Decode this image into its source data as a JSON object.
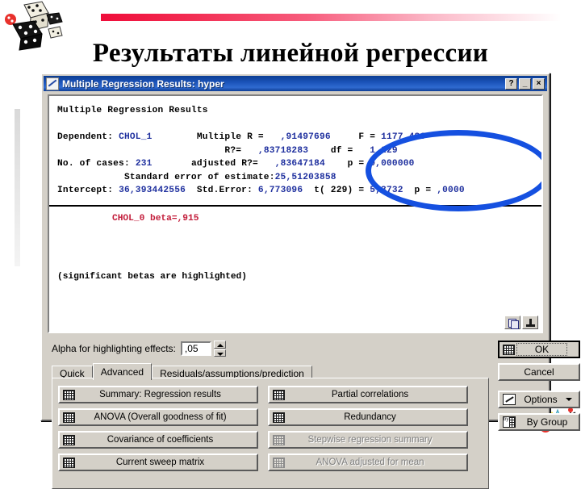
{
  "slide": {
    "title": "Результаты линейной регрессии",
    "accent_color": "#ef0d3a",
    "dice_art_name": "dice-clipart",
    "chart_art_name": "easel-chart-clipart"
  },
  "dialog": {
    "title": "Multiple Regression Results: hyper",
    "titlebar_color": "#1a52b8",
    "buttons": {
      "help": "?",
      "minimize": "_",
      "close": "×"
    }
  },
  "results": {
    "heading": "Multiple Regression Results",
    "lines": [
      {
        "left_label": "Dependent:",
        "left_value": "CHOL_1",
        "mid_label": "Multiple R =",
        "mid_value": ",91497696",
        "right_label": "F =",
        "right_value": "1177,486"
      },
      {
        "left_label": "",
        "left_value": "",
        "mid_label": "R?=",
        "mid_value": ",83718283",
        "right_label": "df =",
        "right_value": "1,229"
      },
      {
        "left_label": "No. of cases:",
        "left_value": "231",
        "mid_label": "adjusted R?=",
        "mid_value": ",83647184",
        "right_label": "p =",
        "right_value": "0,000000"
      }
    ],
    "std_error_label": "Standard error of estimate:",
    "std_error_value": "25,51203858",
    "intercept_label": "Intercept:",
    "intercept_value": "36,393442556",
    "intercept_se_label": "Std.Error:",
    "intercept_se_value": "6,773096",
    "intercept_t_label": "t( 229) =",
    "intercept_t_value": "5,3732",
    "intercept_p_label": "p =",
    "intercept_p_value": ",0000",
    "beta_line": "CHOL_0 beta=,915",
    "note": "(significant betas are highlighted)",
    "highlight_color": "#c21c3a",
    "value_color": "#1e2f9e",
    "annotation_color": "#1550e0",
    "pane_tools": [
      {
        "name": "copy-to-clipboard-button",
        "icon": "copy-icon"
      },
      {
        "name": "pin-output-button",
        "icon": "pin-icon"
      }
    ]
  },
  "alpha": {
    "label": "Alpha for highlighting effects:",
    "value": ",05"
  },
  "tabs": [
    {
      "label": "Quick",
      "active": false
    },
    {
      "label": "Advanced",
      "active": true
    },
    {
      "label": "Residuals/assumptions/prediction",
      "active": false
    }
  ],
  "action_buttons_left": [
    {
      "label": "Summary:  Regression results",
      "disabled": false,
      "icon": "spreadsheet-icon"
    },
    {
      "label": "ANOVA (Overall goodness of fit)",
      "disabled": false,
      "icon": "spreadsheet-icon"
    },
    {
      "label": "Covariance of coefficients",
      "disabled": false,
      "icon": "spreadsheet-icon"
    },
    {
      "label": "Current sweep matrix",
      "disabled": false,
      "icon": "spreadsheet-icon"
    }
  ],
  "action_buttons_right": [
    {
      "label": "Partial correlations",
      "disabled": false,
      "icon": "spreadsheet-icon"
    },
    {
      "label": "Redundancy",
      "disabled": false,
      "icon": "spreadsheet-icon"
    },
    {
      "label": "Stepwise regression summary",
      "disabled": true,
      "icon": "spreadsheet-icon"
    },
    {
      "label": "ANOVA adjusted for mean",
      "disabled": true,
      "icon": "spreadsheet-icon"
    }
  ],
  "side_buttons": {
    "ok": "OK",
    "cancel": "Cancel",
    "options": "Options",
    "by_group": "By Group"
  }
}
